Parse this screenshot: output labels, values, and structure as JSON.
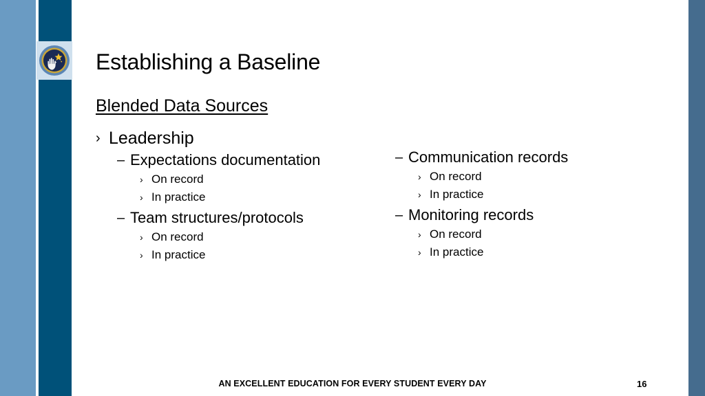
{
  "slide": {
    "title": "Establishing a Baseline",
    "subheading": "Blended Data Sources",
    "footer": "AN EXCELLENT EDUCATION FOR EVERY STUDENT EVERY DAY",
    "slide_number": "16"
  },
  "logo": {
    "name": "hand-and-star-emblem",
    "ring_color": "#C9A63A",
    "disc_color": "#1A2A54",
    "outer_color": "#5B86B5",
    "badge_background": "#CFE0EE",
    "star_color": "#F2C230",
    "hand_color": "#F2F2F2"
  },
  "theme": {
    "band_light_blue": "#6A9BC3",
    "band_dark_blue": "#005179",
    "band_right_blue": "#456C8E",
    "background": "#FFFFFF",
    "text": "#000000"
  },
  "markers": {
    "chevron": "›",
    "dash": "–"
  },
  "content": {
    "left_column": [
      {
        "level": 1,
        "marker": "chevron",
        "text": "Leadership"
      },
      {
        "level": 2,
        "marker": "dash",
        "text": "Expectations documentation"
      },
      {
        "level": 3,
        "marker": "chevron",
        "text": "On record"
      },
      {
        "level": 3,
        "marker": "chevron",
        "text": "In practice"
      },
      {
        "level": 2,
        "marker": "dash",
        "text": "Team structures/protocols"
      },
      {
        "level": 3,
        "marker": "chevron",
        "text": "On record"
      },
      {
        "level": 3,
        "marker": "chevron",
        "text": "In practice"
      }
    ],
    "right_column": [
      {
        "level": 2,
        "marker": "dash",
        "text": "Communication records"
      },
      {
        "level": 3,
        "marker": "chevron",
        "text": "On record"
      },
      {
        "level": 3,
        "marker": "chevron",
        "text": "In practice"
      },
      {
        "level": 2,
        "marker": "dash",
        "text": "Monitoring records"
      },
      {
        "level": 3,
        "marker": "chevron",
        "text": "On record"
      },
      {
        "level": 3,
        "marker": "chevron",
        "text": "In practice"
      }
    ]
  }
}
